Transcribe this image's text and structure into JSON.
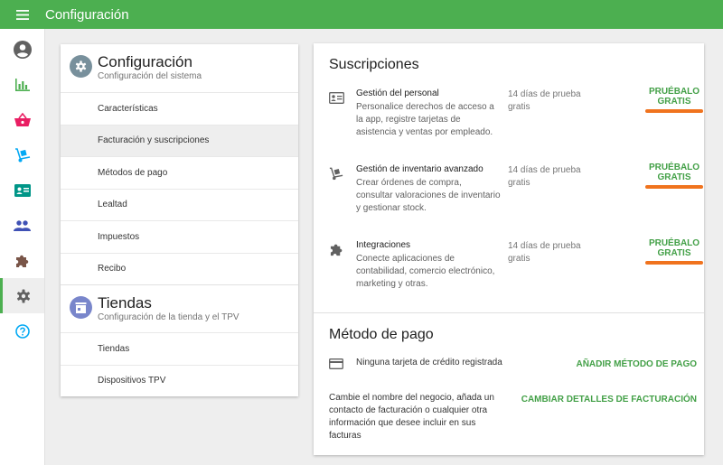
{
  "header": {
    "title": "Configuración",
    "menu_icon": "menu-icon"
  },
  "nav": {
    "items": [
      {
        "name": "account",
        "icon": "account-circle-icon"
      },
      {
        "name": "reports",
        "icon": "bar-chart-icon"
      },
      {
        "name": "sales",
        "icon": "basket-icon"
      },
      {
        "name": "inventory",
        "icon": "hand-truck-icon"
      },
      {
        "name": "employees",
        "icon": "badge-icon"
      },
      {
        "name": "customers",
        "icon": "people-icon"
      },
      {
        "name": "integrations",
        "icon": "puzzle-icon"
      },
      {
        "name": "settings",
        "icon": "gear-icon",
        "active": true
      },
      {
        "name": "help",
        "icon": "help-icon"
      }
    ]
  },
  "left": {
    "config": {
      "title": "Configuración",
      "subtitle": "Configuración del sistema",
      "items": [
        "Características",
        "Facturación y suscripciones",
        "Métodos de pago",
        "Lealtad",
        "Impuestos",
        "Recibo"
      ],
      "selected_index": 1
    },
    "stores": {
      "title": "Tiendas",
      "subtitle": "Configuración de la tienda y el TPV",
      "items": [
        "Tiendas",
        "Dispositivos TPV"
      ]
    }
  },
  "subscriptions": {
    "title": "Suscripciones",
    "items": [
      {
        "name": "Gestión del personal",
        "description": "Personalice derechos de acceso a la app, registre tarjetas de asistencia y ventas por empleado.",
        "trial": "14 días de prueba gratis",
        "button": "PRUÉBALO GRATIS",
        "icon": "id-card-icon"
      },
      {
        "name": "Gestión de inventario avanzado",
        "description": "Crear órdenes de compra, consultar valoraciones de inventario y gestionar stock.",
        "trial": "14 días de prueba gratis",
        "button": "PRUÉBALO GRATIS",
        "icon": "hand-truck-icon"
      },
      {
        "name": "Integraciones",
        "description": "Conecte aplicaciones de contabilidad, comercio electrónico, marketing y otras.",
        "trial": "14 días de prueba gratis",
        "button": "PRUÉBALO GRATIS",
        "icon": "puzzle-icon"
      }
    ]
  },
  "payment": {
    "title": "Método de pago",
    "no_card": "Ninguna tarjeta de crédito registrada",
    "add_button": "AÑADIR MÉTODO DE PAGO",
    "billing_text": "Cambie el nombre del negocio, añada un contacto de facturación o cualquier otra información que desee incluir en sus facturas",
    "billing_button": "CAMBIAR DETALLES DE FACTURACIÓN"
  },
  "colors": {
    "primary": "#4caf50",
    "accent_button": "#43a047",
    "highlight_underline": "#f0731e",
    "config_icon_bg": "#78909c",
    "stores_icon_bg": "#7986cb"
  }
}
